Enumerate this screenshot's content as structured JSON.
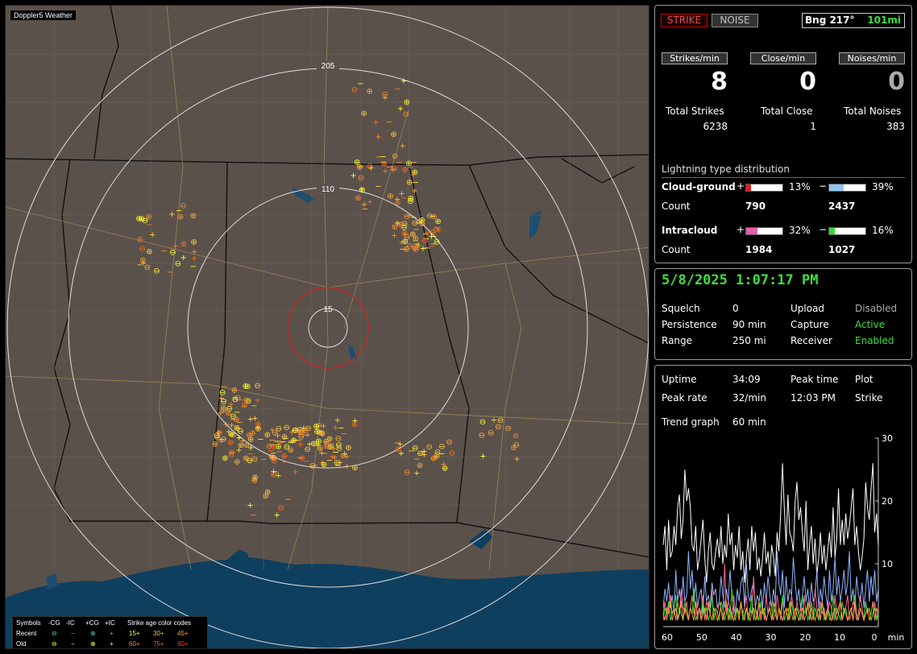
{
  "map": {
    "title": "Doppler5 Weather",
    "ring_labels": [
      "205",
      "110",
      "15"
    ],
    "legend": {
      "col_headers": [
        "Symbols",
        "-CG",
        "-IC",
        "+CG",
        "+IC",
        "Strike age color codes"
      ],
      "rows": [
        {
          "label": "Recent",
          "symbols": [
            "⊖",
            "−",
            "⊕",
            "+"
          ],
          "ages": [
            "15+",
            "30+",
            "45+"
          ]
        },
        {
          "label": "Old",
          "symbols": [
            "⊖",
            "−",
            "⊕",
            "+"
          ],
          "ages": [
            "60+",
            "75+",
            "90+"
          ]
        }
      ]
    }
  },
  "panel_top": {
    "strike_button": "STRIKE",
    "noise_button": "NOISE",
    "bearing": "Bng 217°",
    "range": "101mi",
    "strikes_per_min_label": "Strikes/min",
    "close_per_min_label": "Close/min",
    "noises_per_min_label": "Noises/min",
    "strikes_per_min": "8",
    "close_per_min": "0",
    "noises_per_min": "0",
    "total_strikes_label": "Total Strikes",
    "total_close_label": "Total Close",
    "total_noises_label": "Total Noises",
    "total_strikes": "6238",
    "total_close": "1",
    "total_noises": "383",
    "dist_title": "Lightning type distribution",
    "cg_label": "Cloud-ground",
    "ic_label": "Intracloud",
    "count_label": "Count",
    "plus": "+",
    "minus": "−",
    "cg_pos_pct": "13%",
    "cg_neg_pct": "39%",
    "cg_pos_count": "790",
    "cg_neg_count": "2437",
    "ic_pos_pct": "32%",
    "ic_neg_pct": "16%",
    "ic_pos_count": "1984",
    "ic_neg_count": "1027"
  },
  "panel_mid": {
    "datetime": "5/8/2025 1:07:17 PM",
    "squelch_label": "Squelch",
    "squelch": "0",
    "persistence_label": "Persistence",
    "persistence": "90 min",
    "range_label": "Range",
    "range": "250 mi",
    "upload_label": "Upload",
    "upload": "Disabled",
    "capture_label": "Capture",
    "capture": "Active",
    "receiver_label": "Receiver",
    "receiver": "Enabled"
  },
  "panel_bottom": {
    "uptime_label": "Uptime",
    "uptime": "34:09",
    "peak_time_label": "Peak time",
    "peak_time": "12:03 PM",
    "plot_label": "Plot",
    "plot": "Strike",
    "peak_rate_label": "Peak rate",
    "peak_rate": "32/min",
    "trend_label": "Trend graph",
    "trend": "60 min"
  },
  "chart_data": {
    "type": "line",
    "title": "",
    "xlabel": "min",
    "ylabel": "",
    "x_ticks": [
      "60",
      "50",
      "40",
      "30",
      "20",
      "10",
      "0"
    ],
    "y_ticks": [
      "30",
      "20",
      "10"
    ],
    "xlim": [
      60,
      0
    ],
    "ylim": [
      0,
      30
    ],
    "series": [
      {
        "color": "#ffffff",
        "values": [
          13,
          16,
          9,
          17,
          11,
          12,
          16,
          13,
          19,
          21,
          14,
          17,
          25,
          20,
          22,
          19,
          13,
          12,
          16,
          9,
          11,
          14,
          17,
          11,
          7,
          12,
          15,
          10,
          9,
          12,
          14,
          11,
          16,
          10,
          13,
          11,
          18,
          13,
          15,
          9,
          13,
          11,
          16,
          9,
          12,
          7,
          11,
          14,
          9,
          16,
          12,
          15,
          9,
          11,
          8,
          11,
          15,
          10,
          12,
          8,
          13,
          11,
          8,
          15,
          12,
          18,
          26,
          19,
          13,
          21,
          15,
          14,
          12,
          20,
          23,
          17,
          19,
          15,
          12,
          20,
          9,
          13,
          16,
          10,
          14,
          8,
          11,
          15,
          10,
          13,
          9,
          12,
          15,
          11,
          19,
          11,
          14,
          22,
          13,
          17,
          13,
          18,
          14,
          16,
          19,
          22,
          13,
          16,
          12,
          9,
          11,
          14,
          23,
          19,
          17,
          22,
          26,
          15,
          18,
          13
        ]
      },
      {
        "color": "#8fb3ff",
        "values": [
          3,
          6,
          4,
          7,
          3,
          5,
          2,
          9,
          4,
          6,
          3,
          8,
          4,
          5,
          12,
          6,
          9,
          4,
          7,
          3,
          5,
          6,
          2,
          8,
          4,
          5,
          3,
          7,
          5,
          6,
          3,
          4,
          8,
          5,
          3,
          6,
          4,
          9,
          5,
          3,
          2,
          6,
          4,
          7,
          8,
          3,
          10,
          5,
          4,
          6,
          7,
          3,
          5,
          4,
          6,
          3,
          7,
          4,
          8,
          5,
          3,
          6,
          4,
          12,
          7,
          5,
          9,
          3,
          8,
          4,
          6,
          5,
          11,
          7,
          4,
          6,
          3,
          5,
          8,
          4,
          6,
          3,
          7,
          4,
          5,
          9,
          3,
          6,
          4,
          8,
          5,
          3,
          9,
          4,
          6,
          11,
          5,
          8,
          4,
          6,
          9,
          5,
          7,
          12,
          4,
          6,
          3,
          8,
          5,
          4,
          7,
          3,
          6,
          9,
          4,
          8,
          5,
          9,
          4,
          6
        ]
      },
      {
        "color": "#ff6699",
        "values": [
          2,
          4,
          1,
          3,
          5,
          2,
          3,
          1,
          4,
          2,
          6,
          3,
          2,
          4,
          1,
          3,
          5,
          2,
          4,
          1,
          3,
          2,
          5,
          1,
          4,
          3,
          2,
          6,
          1,
          3,
          2,
          4,
          3,
          1,
          10,
          2,
          4,
          3,
          1,
          5,
          2,
          3,
          1,
          4,
          2,
          3,
          5,
          1,
          3,
          2,
          8,
          3,
          1,
          4,
          2,
          3,
          1,
          5,
          2,
          4,
          3,
          1,
          2,
          5,
          3,
          1,
          4,
          2,
          3,
          1,
          2,
          5,
          3,
          1,
          4,
          2,
          3,
          1,
          5,
          2,
          3,
          4,
          1,
          2,
          6,
          3,
          1,
          4,
          2,
          3,
          1,
          2,
          4,
          3,
          1,
          5,
          2,
          3,
          4,
          1,
          2,
          3,
          5,
          1,
          2,
          4,
          3,
          1,
          2,
          5,
          3,
          1,
          4,
          2,
          3,
          1,
          2,
          4,
          1,
          3
        ]
      },
      {
        "color": "#33e033",
        "values": [
          1,
          3,
          2,
          4,
          1,
          2,
          3,
          5,
          1,
          3,
          2,
          1,
          4,
          2,
          1,
          3,
          2,
          6,
          1,
          2,
          3,
          1,
          4,
          2,
          3,
          1,
          2,
          5,
          1,
          3,
          2,
          1,
          4,
          3,
          1,
          2,
          3,
          1,
          6,
          2,
          1,
          3,
          2,
          4,
          1,
          2,
          3,
          1,
          2,
          5,
          1,
          3,
          2,
          1,
          4,
          2,
          3,
          1,
          2,
          3,
          1,
          4,
          2,
          1,
          3,
          2,
          5,
          1,
          2,
          3,
          1,
          4,
          2,
          1,
          3,
          2,
          1,
          5,
          2,
          3,
          1,
          2,
          4,
          1,
          3,
          2,
          1,
          3,
          4,
          1,
          2,
          3,
          1,
          2,
          5,
          1,
          3,
          2,
          1,
          4,
          2,
          3,
          1,
          2,
          3,
          1,
          5,
          2,
          1,
          3,
          2,
          1,
          4,
          2,
          3,
          1,
          2,
          3,
          1,
          2
        ]
      },
      {
        "color": "#ff9933",
        "values": [
          2,
          1,
          3,
          2,
          4,
          1,
          2,
          3,
          1,
          2,
          4,
          1,
          3,
          2,
          1,
          3,
          2,
          1,
          4,
          2,
          3,
          1,
          2,
          3,
          1,
          4,
          2,
          1,
          3,
          2,
          1,
          2,
          3,
          1,
          2,
          4,
          1,
          3,
          2,
          1,
          2,
          3,
          1,
          4,
          2,
          1,
          3,
          2,
          1,
          2,
          3,
          1,
          2,
          4,
          1,
          3,
          2,
          1,
          2,
          3,
          1,
          2,
          4,
          1,
          3,
          2,
          1,
          2,
          3,
          1,
          4,
          2,
          1,
          3,
          2,
          1,
          2,
          3,
          1,
          2,
          4,
          1,
          3,
          2,
          1,
          2,
          3,
          1,
          4,
          2,
          1,
          3,
          2,
          1,
          2,
          3,
          1,
          2,
          4,
          1,
          3,
          2,
          1,
          2,
          3,
          1,
          4,
          2,
          1,
          3,
          2,
          1,
          2,
          3,
          1,
          2,
          4,
          1,
          3,
          2
        ]
      }
    ]
  }
}
